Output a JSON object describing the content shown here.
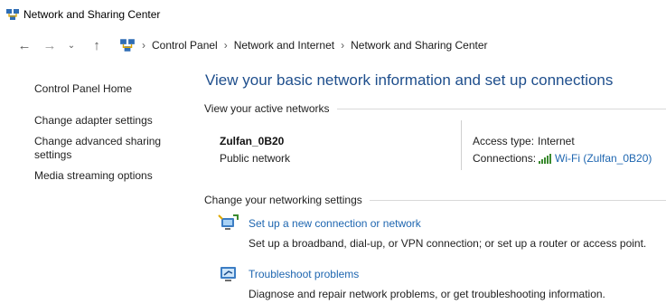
{
  "window": {
    "title": "Network and Sharing Center"
  },
  "nav": {
    "icons": {
      "back": "arrow-left-icon",
      "forward": "arrow-right-icon",
      "recent": "chevron-down-icon",
      "up": "arrow-up-icon"
    },
    "breadcrumb": [
      "Control Panel",
      "Network and Internet",
      "Network and Sharing Center"
    ]
  },
  "sidebar": {
    "items": [
      {
        "label": "Control Panel Home"
      },
      {
        "label": "Change adapter settings"
      },
      {
        "label": "Change advanced sharing settings"
      },
      {
        "label": "Media streaming options"
      }
    ]
  },
  "main": {
    "title": "View your basic network information and set up connections",
    "active_networks": {
      "heading": "View your active networks",
      "name": "Zulfan_0B20",
      "category": "Public network",
      "access_type_label": "Access type:",
      "access_type_value": "Internet",
      "connections_label": "Connections:",
      "connections_value": "Wi-Fi (Zulfan_0B20)"
    },
    "change_settings": {
      "heading": "Change your networking settings",
      "tasks": [
        {
          "link": "Set up a new connection or network",
          "desc": "Set up a broadband, dial-up, or VPN connection; or set up a router or access point."
        },
        {
          "link": "Troubleshoot problems",
          "desc": "Diagnose and repair network problems, or get troubleshooting information."
        }
      ]
    }
  },
  "colors": {
    "heading_blue": "#1e4e8c",
    "link_blue": "#1e66b0",
    "wifi_green": "#3a8a2f"
  }
}
